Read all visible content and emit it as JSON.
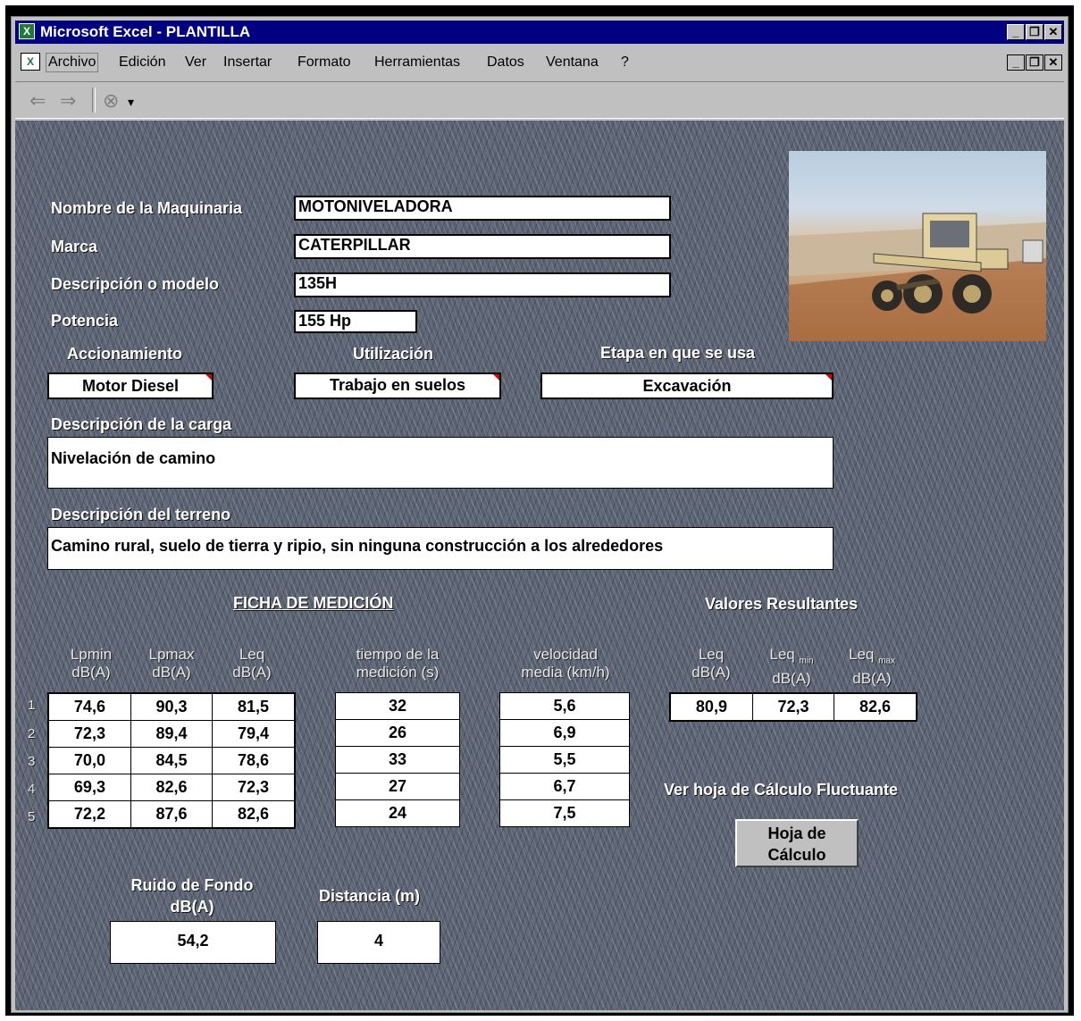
{
  "window": {
    "title": "Microsoft Excel - PLANTILLA"
  },
  "menu": [
    "Archivo",
    "Edición",
    "Ver",
    "Insertar",
    "Formato",
    "Herramientas",
    "Datos",
    "Ventana",
    "?"
  ],
  "form": {
    "nombre_label": "Nombre de la Maquinaria",
    "nombre_value": "MOTONIVELADORA",
    "marca_label": "Marca",
    "marca_value": "CATERPILLAR",
    "modelo_label": "Descripción o modelo",
    "modelo_value": "135H",
    "potencia_label": "Potencia",
    "potencia_value": "155 Hp",
    "accionamiento_label": "Accionamiento",
    "accionamiento_value": "Motor Diesel",
    "utilizacion_label": "Utilización",
    "utilizacion_value": "Trabajo en suelos",
    "etapa_label": "Etapa en que se usa",
    "etapa_value": "Excavación",
    "carga_label": "Descripción de la carga",
    "carga_value": "Nivelación de camino",
    "terreno_label": "Descripción del terreno",
    "terreno_value": "Camino rural, suelo de tierra y ripio, sin ninguna construcción a los alrededores"
  },
  "ficha": {
    "title": "FICHA DE MEDICIÓN",
    "headers": {
      "lpmin": [
        "Lpmin",
        "dB(A)"
      ],
      "lpmax": [
        "Lpmax",
        "dB(A)"
      ],
      "leq": [
        "Leq",
        "dB(A)"
      ],
      "tiempo": [
        "tiempo de la",
        "medición (s)"
      ],
      "velocidad": [
        "velocidad",
        "media (km/h)"
      ]
    },
    "row_numbers": [
      "1",
      "2",
      "3",
      "4",
      "5"
    ],
    "levels": [
      [
        "74,6",
        "90,3",
        "81,5"
      ],
      [
        "72,3",
        "89,4",
        "79,4"
      ],
      [
        "70,0",
        "84,5",
        "78,6"
      ],
      [
        "69,3",
        "82,6",
        "72,3"
      ],
      [
        "72,2",
        "87,6",
        "82,6"
      ]
    ],
    "tiempo": [
      "32",
      "26",
      "33",
      "27",
      "24"
    ],
    "velocidad": [
      "5,6",
      "6,9",
      "5,5",
      "6,7",
      "7,5"
    ]
  },
  "resultados": {
    "title": "Valores Resultantes",
    "headers": {
      "leq": [
        "Leq",
        "dB(A)"
      ],
      "leq_min": [
        "Leq",
        "min",
        "dB(A)"
      ],
      "leq_max": [
        "Leq",
        "max",
        "dB(A)"
      ]
    },
    "values": [
      "80,9",
      "72,3",
      "82,6"
    ]
  },
  "fluctuante": {
    "label": "Ver hoja de Cálculo Fluctuante",
    "button_line1": "Hoja de",
    "button_line2": "Cálculo"
  },
  "fondo": {
    "label_line1": "Ruido de Fondo",
    "label_line2": "dB(A)",
    "value": "54,2"
  },
  "distancia": {
    "label": "Distancia (m)",
    "value": "4"
  },
  "colors": {
    "titlebar": "#000080",
    "sheet": "#5a6272"
  }
}
